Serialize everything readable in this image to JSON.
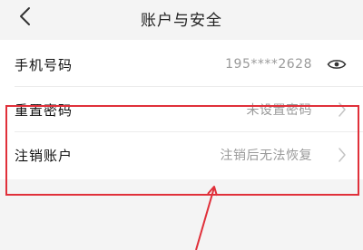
{
  "header": {
    "title": "账户与安全",
    "back_icon": "chevron-left-icon"
  },
  "rows": [
    {
      "label": "手机号码",
      "value": "195****2628",
      "icon": "eye-icon"
    },
    {
      "label": "重置密码",
      "value": "未设置密码",
      "icon": "chevron-right-icon"
    },
    {
      "label": "注销账户",
      "value": "注销后无法恢复",
      "icon": "chevron-right-icon"
    }
  ],
  "annotation": {
    "color": "#e0303a"
  }
}
